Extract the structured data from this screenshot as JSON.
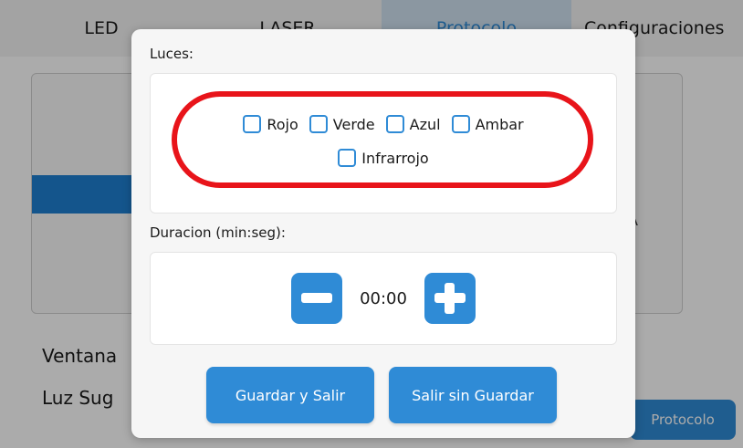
{
  "background": {
    "tabs": [
      {
        "label": "LED"
      },
      {
        "label": "LASER"
      },
      {
        "label": "Protocolo"
      },
      {
        "label": "Configuraciones"
      }
    ],
    "side_letter": "A",
    "label_ventana": "Ventana",
    "label_luz": "Luz Sug",
    "protocolo_button": "Protocolo"
  },
  "modal": {
    "luces_label": "Luces:",
    "lights": [
      {
        "label": "Rojo",
        "checked": false
      },
      {
        "label": "Verde",
        "checked": false
      },
      {
        "label": "Azul",
        "checked": false
      },
      {
        "label": "Ambar",
        "checked": false
      },
      {
        "label": "Infrarrojo",
        "checked": false
      }
    ],
    "duracion_label": "Duracion (min:seg):",
    "duration_value": "00:00",
    "save_label": "Guardar y Salir",
    "exit_label": "Salir sin Guardar"
  },
  "colors": {
    "accent": "#2f8bd6",
    "highlight": "#e8141a"
  }
}
